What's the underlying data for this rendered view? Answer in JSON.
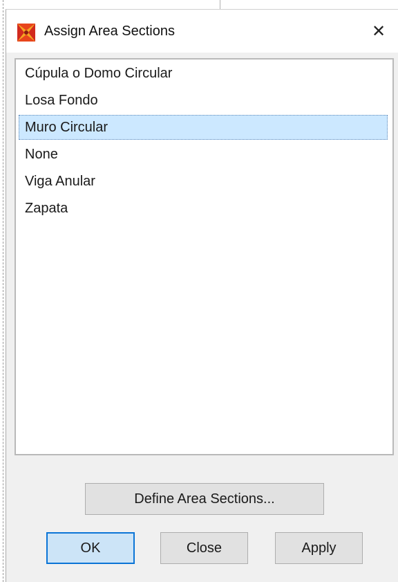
{
  "window": {
    "title": "Assign Area Sections",
    "app_icon": "sap2000-icon",
    "close_glyph": "✕"
  },
  "sections_list": {
    "items": [
      {
        "label": "Cúpula o Domo Circular",
        "selected": false
      },
      {
        "label": "Losa Fondo",
        "selected": false
      },
      {
        "label": "Muro Circular",
        "selected": true
      },
      {
        "label": "None",
        "selected": false
      },
      {
        "label": "Viga Anular",
        "selected": false
      },
      {
        "label": "Zapata",
        "selected": false
      }
    ]
  },
  "buttons": {
    "define_label": "Define Area Sections...",
    "ok_label": "OK",
    "close_label": "Close",
    "apply_label": "Apply"
  },
  "colors": {
    "selection_bg": "#cce8ff",
    "default_button_border": "#0a74d6",
    "icon_red": "#d22a1e",
    "icon_orange": "#f5a623"
  }
}
